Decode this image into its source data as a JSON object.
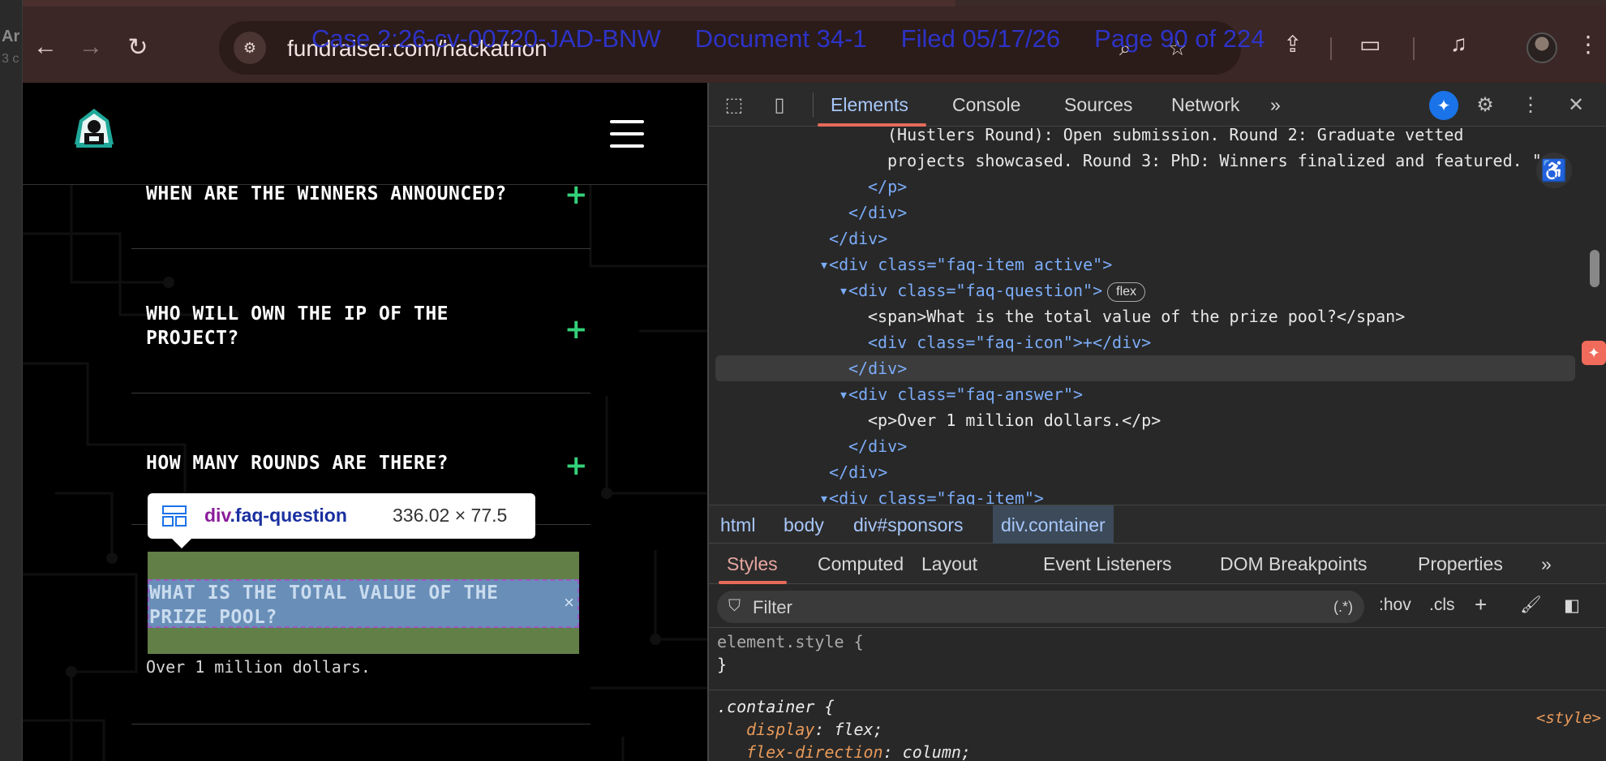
{
  "background_window": {
    "text1": "Ar",
    "text2": "3 c"
  },
  "browser": {
    "url": "fundraiser.com/hackathon",
    "icons": [
      "back-icon",
      "forward-icon",
      "reload-icon",
      "site-info-icon",
      "search-icon",
      "bookmark-star-icon",
      "install-app-icon",
      "tab-search-icon",
      "media-controls-icon",
      "profile-avatar",
      "kebab-menu-icon"
    ]
  },
  "court_header": {
    "case": "Case 2:26-cv-00720-JAD-BNW",
    "document": "Document 34-1",
    "filed": "Filed 05/17/26",
    "page": "Page 90 of 224"
  },
  "site": {
    "faq": [
      {
        "question": "WHEN ARE THE WINNERS ANNOUNCED?",
        "icon": "+"
      },
      {
        "question": "WHO WILL OWN THE IP OF THE\nPROJECT?",
        "icon": "+"
      },
      {
        "question": "HOW MANY ROUNDS ARE THERE?",
        "icon": "+"
      },
      {
        "question": "WHAT IS THE TOTAL VALUE OF THE\nPRIZE POOL?",
        "icon": "×",
        "answer": "Over 1 million dollars."
      }
    ],
    "inspect_tooltip": {
      "tag": "div",
      "class": ".faq-question",
      "size": "336.02 × 77.5"
    }
  },
  "devtools": {
    "tabs": [
      "Elements",
      "Console",
      "Sources",
      "Network",
      "»"
    ],
    "active_tab": "Elements",
    "code_lines": [
      "(Hustlers Round): Open submission. Round 2: Graduate vetted",
      "projects showcased. Round 3: PhD: Winners finalized and featured. \"",
      "</p>",
      "</div>",
      "</div>",
      "<div class=\"faq-item active\">",
      "<div class=\"faq-question\">",
      "flex",
      "<span>What is the total value of the prize pool?</span>",
      "<div class=\"faq-icon\">+</div>",
      "</div>",
      "<div class=\"faq-answer\">",
      "<p>Over 1 million dollars.</p>",
      "</div>",
      "</div>",
      "<div class=\"faq-item\">"
    ],
    "breadcrumb": [
      "html",
      "body",
      "div#sponsors",
      "div.container"
    ],
    "sub_tabs": [
      "Styles",
      "Computed",
      "Layout",
      "Event Listeners",
      "DOM Breakpoints",
      "Properties",
      "»"
    ],
    "active_sub_tab": "Styles",
    "filter": {
      "placeholder": "Filter",
      "regex": "(.*)",
      "hov": ":hov",
      "cls": ".cls"
    },
    "styles": {
      "element_style": "element.style {",
      "close_brace": "}",
      "selector": ".container {",
      "props": [
        {
          "name": "display",
          "value": "flex;"
        },
        {
          "name": "flex-direction",
          "value": "column;"
        }
      ],
      "source": "<style>"
    }
  }
}
